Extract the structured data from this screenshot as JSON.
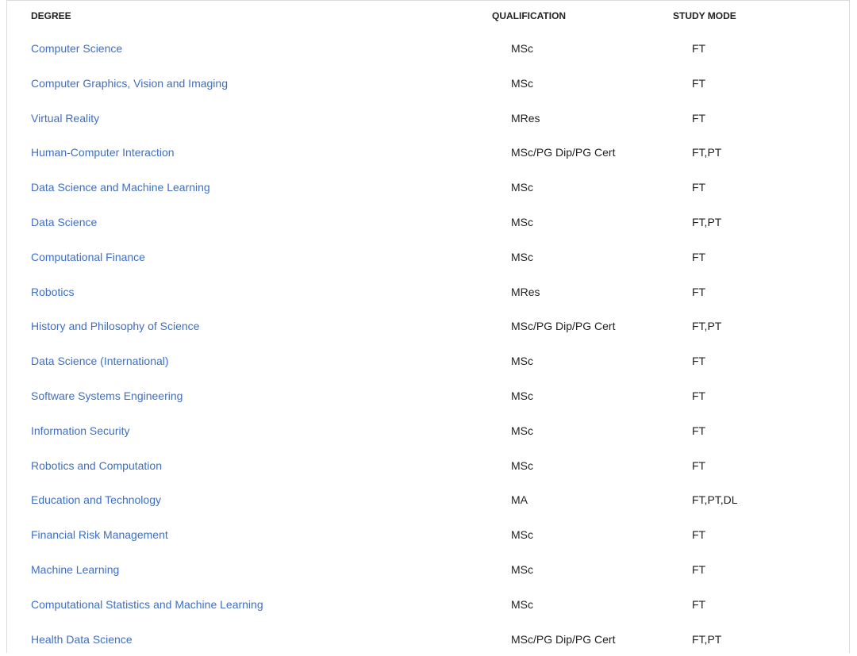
{
  "table": {
    "headers": {
      "degree": "DEGREE",
      "qualification": "QUALIFICATION",
      "study_mode": "STUDY MODE"
    },
    "rows": [
      {
        "degree": "Computer Science",
        "qualification": "MSc",
        "study_mode": "FT"
      },
      {
        "degree": "Computer Graphics, Vision and Imaging",
        "qualification": "MSc",
        "study_mode": "FT"
      },
      {
        "degree": "Virtual Reality",
        "qualification": "MRes",
        "study_mode": "FT"
      },
      {
        "degree": "Human-Computer Interaction",
        "qualification": "MSc/PG Dip/PG Cert",
        "study_mode": "FT,PT"
      },
      {
        "degree": "Data Science and Machine Learning",
        "qualification": "MSc",
        "study_mode": "FT"
      },
      {
        "degree": "Data Science",
        "qualification": "MSc",
        "study_mode": "FT,PT"
      },
      {
        "degree": "Computational Finance",
        "qualification": "MSc",
        "study_mode": "FT"
      },
      {
        "degree": "Robotics",
        "qualification": "MRes",
        "study_mode": "FT"
      },
      {
        "degree": "History and Philosophy of Science",
        "qualification": "MSc/PG Dip/PG Cert",
        "study_mode": "FT,PT"
      },
      {
        "degree": "Data Science (International)",
        "qualification": "MSc",
        "study_mode": "FT"
      },
      {
        "degree": "Software Systems Engineering",
        "qualification": "MSc",
        "study_mode": "FT"
      },
      {
        "degree": "Information Security",
        "qualification": "MSc",
        "study_mode": "FT"
      },
      {
        "degree": "Robotics and Computation",
        "qualification": "MSc",
        "study_mode": "FT"
      },
      {
        "degree": "Education and Technology",
        "qualification": "MA",
        "study_mode": "FT,PT,DL"
      },
      {
        "degree": "Financial Risk Management",
        "qualification": "MSc",
        "study_mode": "FT"
      },
      {
        "degree": "Machine Learning",
        "qualification": "MSc",
        "study_mode": "FT"
      },
      {
        "degree": "Computational Statistics and Machine Learning",
        "qualification": "MSc",
        "study_mode": "FT"
      },
      {
        "degree": "Health Data Science",
        "qualification": "MSc/PG Dip/PG Cert",
        "study_mode": "FT,PT"
      }
    ]
  },
  "colors": {
    "link": "#3f6fc2",
    "text": "#222222",
    "border": "#dcdcdc"
  }
}
